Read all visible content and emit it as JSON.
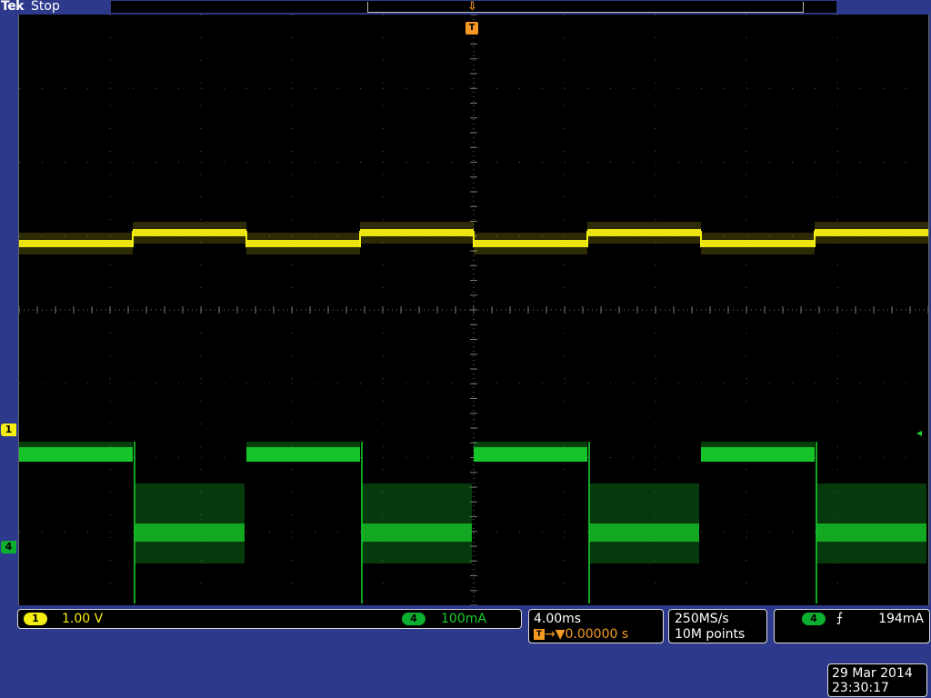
{
  "header": {
    "brand": "Tek",
    "run_state": "Stop"
  },
  "trigger_marker": {
    "label": "T"
  },
  "channels": {
    "ch1": {
      "number": "1",
      "scale": "1.00 V",
      "color": "#f5ee12"
    },
    "ch4": {
      "number": "4",
      "scale": "100mA",
      "color": "#17cd2a"
    }
  },
  "timebase": {
    "scale": "4.00ms",
    "position": "0.00000 s",
    "trig_icon": "T",
    "trig_pos_icon": "→▼"
  },
  "acquisition": {
    "sample_rate": "250MS/s",
    "record_length": "10M points"
  },
  "trigger": {
    "source": "4",
    "slope": "rising-edge-icon",
    "slope_glyph": "⨍",
    "level": "194mA",
    "level_marker": "◂"
  },
  "datetime": {
    "date": "29 Mar 2014",
    "time": "23:30:17"
  }
}
